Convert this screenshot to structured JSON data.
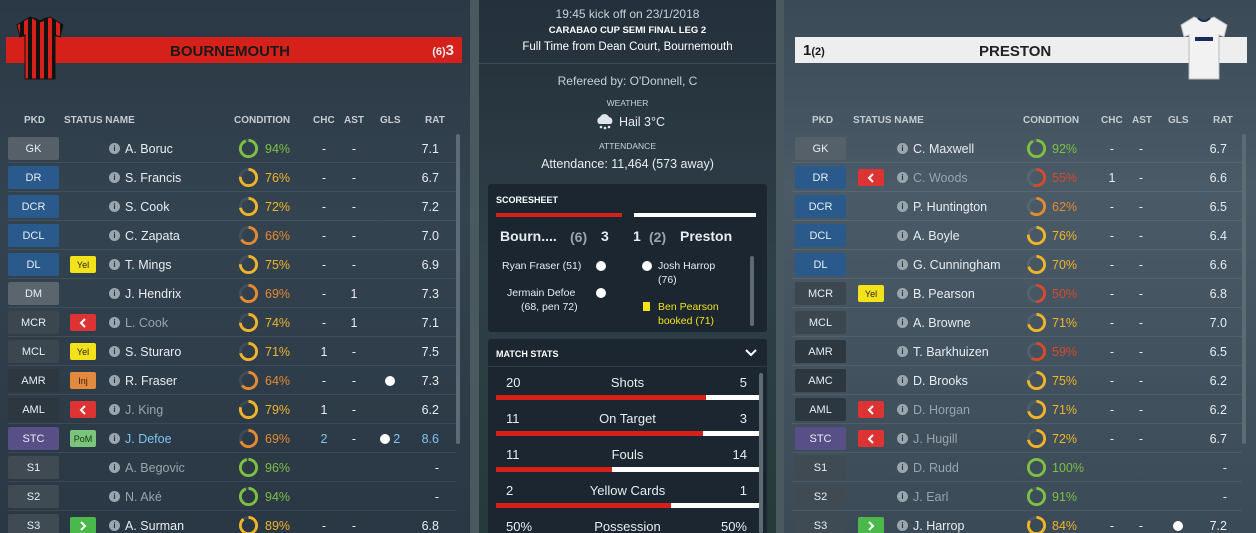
{
  "home": {
    "name": "BOURNEMOUTH",
    "pens": "(6)",
    "goals": "3",
    "color": "#d6211b"
  },
  "away": {
    "name": "PRESTON",
    "pens": "(2)",
    "goals": "1",
    "color": "#eeeeee"
  },
  "headers": {
    "pkd": "PKD",
    "status_name": "STATUS NAME",
    "condition": "CONDITION",
    "chc": "CHC",
    "ast": "AST",
    "gls": "GLS",
    "rat": "RAT"
  },
  "home_players": [
    {
      "pos": "GK",
      "pc": "gk",
      "status": "",
      "name": "A. Boruc",
      "cond": "94%",
      "c": 94,
      "chc": "-",
      "ast": "-",
      "gls": "",
      "rat": "7.1"
    },
    {
      "pos": "DR",
      "pc": "df",
      "status": "",
      "name": "S. Francis",
      "cond": "76%",
      "c": 76,
      "chc": "-",
      "ast": "-",
      "gls": "",
      "rat": "6.7"
    },
    {
      "pos": "DCR",
      "pc": "df",
      "status": "",
      "name": "S. Cook",
      "cond": "72%",
      "c": 72,
      "chc": "-",
      "ast": "-",
      "gls": "",
      "rat": "7.2"
    },
    {
      "pos": "DCL",
      "pc": "df",
      "status": "",
      "name": "C. Zapata",
      "cond": "66%",
      "c": 66,
      "chc": "-",
      "ast": "-",
      "gls": "",
      "rat": "7.0"
    },
    {
      "pos": "DL",
      "pc": "df",
      "status": "Yel",
      "name": "T. Mings",
      "cond": "75%",
      "c": 75,
      "chc": "-",
      "ast": "-",
      "gls": "",
      "rat": "6.9"
    },
    {
      "pos": "DM",
      "pc": "dm",
      "status": "",
      "name": "J. Hendrix",
      "cond": "69%",
      "c": 69,
      "chc": "-",
      "ast": "1",
      "gls": "",
      "rat": "7.3"
    },
    {
      "pos": "MCR",
      "pc": "mc",
      "status": "out",
      "name": "L. Cook",
      "cond": "74%",
      "c": 74,
      "chc": "-",
      "ast": "1",
      "gls": "",
      "rat": "7.1",
      "dim": true
    },
    {
      "pos": "MCL",
      "pc": "mc",
      "status": "Yel",
      "name": "S. Sturaro",
      "cond": "71%",
      "c": 71,
      "chc": "1",
      "ast": "-",
      "gls": "",
      "rat": "7.5"
    },
    {
      "pos": "AMR",
      "pc": "am",
      "status": "Inj",
      "name": "R. Fraser",
      "cond": "64%",
      "c": 64,
      "chc": "-",
      "ast": "-",
      "gls": "ball",
      "rat": "7.3"
    },
    {
      "pos": "AML",
      "pc": "am",
      "status": "out",
      "name": "J. King",
      "cond": "79%",
      "c": 79,
      "chc": "1",
      "ast": "-",
      "gls": "",
      "rat": "6.2",
      "dim": true
    },
    {
      "pos": "STC",
      "pc": "st",
      "status": "PoM",
      "name": "J. Defoe",
      "cond": "69%",
      "c": 69,
      "chc": "2",
      "ast": "-",
      "gls": "ball2",
      "rat": "8.6",
      "blue": true
    },
    {
      "pos": "S1",
      "pc": "sub",
      "status": "",
      "name": "A. Begovic",
      "cond": "96%",
      "c": 96,
      "chc": "",
      "ast": "",
      "gls": "",
      "rat": "-",
      "dim": true
    },
    {
      "pos": "S2",
      "pc": "sub",
      "status": "",
      "name": "N. Aké",
      "cond": "94%",
      "c": 94,
      "chc": "",
      "ast": "",
      "gls": "",
      "rat": "-",
      "dim": true
    },
    {
      "pos": "S3",
      "pc": "sub",
      "status": "in",
      "name": "A. Surman",
      "cond": "89%",
      "c": 89,
      "chc": "-",
      "ast": "-",
      "gls": "",
      "rat": "6.8"
    }
  ],
  "away_players": [
    {
      "pos": "GK",
      "pc": "gk",
      "status": "",
      "name": "C. Maxwell",
      "cond": "92%",
      "c": 92,
      "chc": "-",
      "ast": "-",
      "gls": "",
      "rat": "6.7"
    },
    {
      "pos": "DR",
      "pc": "df",
      "status": "out",
      "name": "C. Woods",
      "cond": "55%",
      "c": 55,
      "chc": "1",
      "ast": "-",
      "gls": "",
      "rat": "6.6",
      "dim": true
    },
    {
      "pos": "DCR",
      "pc": "df",
      "status": "",
      "name": "P. Huntington",
      "cond": "62%",
      "c": 62,
      "chc": "-",
      "ast": "-",
      "gls": "",
      "rat": "6.5"
    },
    {
      "pos": "DCL",
      "pc": "df",
      "status": "",
      "name": "A. Boyle",
      "cond": "76%",
      "c": 76,
      "chc": "-",
      "ast": "-",
      "gls": "",
      "rat": "6.4"
    },
    {
      "pos": "DL",
      "pc": "df",
      "status": "",
      "name": "G. Cunningham",
      "cond": "70%",
      "c": 70,
      "chc": "-",
      "ast": "-",
      "gls": "",
      "rat": "6.6"
    },
    {
      "pos": "MCR",
      "pc": "mc",
      "status": "Yel",
      "name": "B. Pearson",
      "cond": "50%",
      "c": 50,
      "chc": "-",
      "ast": "-",
      "gls": "",
      "rat": "6.8"
    },
    {
      "pos": "MCL",
      "pc": "mc",
      "status": "",
      "name": "A. Browne",
      "cond": "71%",
      "c": 71,
      "chc": "-",
      "ast": "-",
      "gls": "",
      "rat": "7.0"
    },
    {
      "pos": "AMR",
      "pc": "am",
      "status": "",
      "name": "T. Barkhuizen",
      "cond": "59%",
      "c": 59,
      "chc": "-",
      "ast": "-",
      "gls": "",
      "rat": "6.5"
    },
    {
      "pos": "AMC",
      "pc": "am",
      "status": "",
      "name": "D. Brooks",
      "cond": "75%",
      "c": 75,
      "chc": "-",
      "ast": "-",
      "gls": "",
      "rat": "6.2"
    },
    {
      "pos": "AML",
      "pc": "am",
      "status": "out",
      "name": "D. Horgan",
      "cond": "71%",
      "c": 71,
      "chc": "-",
      "ast": "-",
      "gls": "",
      "rat": "6.2",
      "dim": true
    },
    {
      "pos": "STC",
      "pc": "st",
      "status": "out",
      "name": "J. Hugill",
      "cond": "72%",
      "c": 72,
      "chc": "-",
      "ast": "-",
      "gls": "",
      "rat": "6.7",
      "dim": true
    },
    {
      "pos": "S1",
      "pc": "sub",
      "status": "",
      "name": "D. Rudd",
      "cond": "100%",
      "c": 100,
      "chc": "",
      "ast": "",
      "gls": "",
      "rat": "-",
      "dim": true
    },
    {
      "pos": "S2",
      "pc": "sub",
      "status": "",
      "name": "J. Earl",
      "cond": "91%",
      "c": 91,
      "chc": "",
      "ast": "",
      "gls": "",
      "rat": "-",
      "dim": true
    },
    {
      "pos": "S3",
      "pc": "sub",
      "status": "in",
      "name": "J. Harrop",
      "cond": "84%",
      "c": 84,
      "chc": "-",
      "ast": "-",
      "gls": "ball",
      "rat": "7.2"
    }
  ],
  "match": {
    "kickoff": "19:45 kick off on 23/1/2018",
    "competition": "CARABAO CUP SEMI FINAL LEG 2",
    "result": "Full Time from Dean Court, Bournemouth",
    "referee": "Refereed by: O'Donnell, C",
    "weather_label": "WEATHER",
    "weather": "Hail 3°C",
    "attendance_label": "ATTENDANCE",
    "attendance": "Attendance: 11,464 (573 away)"
  },
  "scoresheet": {
    "title": "SCORESHEET",
    "home_short": "Bourn....",
    "home_pens": "(6)",
    "home_goals": "3",
    "away_goals": "1",
    "away_pens": "(2)",
    "away_short": "Preston",
    "home_events": [
      "Ryan Fraser (51)",
      "Jermain Defoe",
      "(68, pen 72)"
    ],
    "away_events": [
      "Josh Harrop",
      "(76)",
      "Ben Pearson",
      "booked (71)"
    ]
  },
  "match_stats": {
    "title": "MATCH STATS",
    "rows": [
      {
        "label": "Shots",
        "home": "20",
        "away": "5",
        "home_share": 0.8
      },
      {
        "label": "On Target",
        "home": "11",
        "away": "3",
        "home_share": 0.786
      },
      {
        "label": "Fouls",
        "home": "11",
        "away": "14",
        "home_share": 0.44
      },
      {
        "label": "Yellow Cards",
        "home": "2",
        "away": "1",
        "home_share": 0.667
      },
      {
        "label": "Possession",
        "home": "50%",
        "away": "50%",
        "home_share": 0.5
      }
    ]
  }
}
